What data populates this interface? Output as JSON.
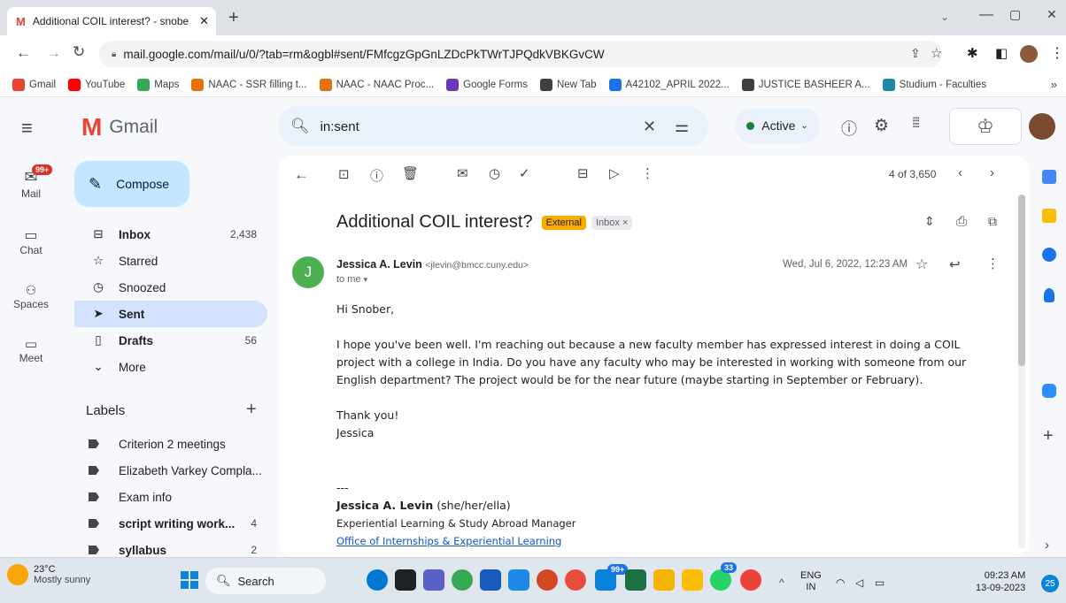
{
  "browser": {
    "tab_title": "Additional COIL interest? - snobe",
    "url": "mail.google.com/mail/u/0/?tab=rm&ogbl#sent/FMfcgzGpGnLZDcPkTWrTJPQdkVBKGvCW",
    "bookmarks": [
      {
        "label": "Gmail",
        "color": "#ea4335"
      },
      {
        "label": "YouTube",
        "color": "#ff0000"
      },
      {
        "label": "Maps",
        "color": "#34a853"
      },
      {
        "label": "NAAC - SSR filling t...",
        "color": "#e8710a"
      },
      {
        "label": "NAAC - NAAC Proc...",
        "color": "#e8710a"
      },
      {
        "label": "Google Forms",
        "color": "#673ab7"
      },
      {
        "label": "New Tab",
        "color": "#3c4043"
      },
      {
        "label": "A42102_APRIL 2022...",
        "color": "#1a73e8"
      },
      {
        "label": "JUSTICE BASHEER A...",
        "color": "#3c4043"
      },
      {
        "label": "Studium - Faculties",
        "color": "#1e88a8"
      }
    ],
    "more": "»"
  },
  "gmail": {
    "logo_text": "Gmail",
    "search_value": "in:sent",
    "status": "Active",
    "rail": [
      {
        "label": "Mail",
        "badge": "99+"
      },
      {
        "label": "Chat"
      },
      {
        "label": "Spaces"
      },
      {
        "label": "Meet"
      }
    ],
    "compose_label": "Compose",
    "nav": [
      {
        "label": "Inbox",
        "count": "2,438",
        "bold": true
      },
      {
        "label": "Starred",
        "count": "",
        "bold": false
      },
      {
        "label": "Snoozed",
        "count": "",
        "bold": false
      },
      {
        "label": "Sent",
        "count": "",
        "bold": true
      },
      {
        "label": "Drafts",
        "count": "56",
        "bold": true
      },
      {
        "label": "More",
        "count": "",
        "bold": false
      }
    ],
    "labels_heading": "Labels",
    "labels": [
      {
        "label": "Criterion 2 meetings",
        "count": "",
        "bold": false
      },
      {
        "label": "Elizabeth Varkey Compla...",
        "count": "",
        "bold": false
      },
      {
        "label": "Exam info",
        "count": "",
        "bold": false
      },
      {
        "label": "script writing work...",
        "count": "4",
        "bold": true
      },
      {
        "label": "syllabus",
        "count": "2",
        "bold": true
      }
    ],
    "pager": "4 of 3,650",
    "email": {
      "subject": "Additional COIL interest?",
      "tag_external": "External",
      "tag_inbox": "Inbox",
      "avatar_letter": "J",
      "sender_name": "Jessica A. Levin",
      "sender_email": "<jlevin@bmcc.cuny.edu>",
      "to": "to me",
      "date": "Wed, Jul 6, 2022, 12:23 AM",
      "greeting": "Hi Snober,",
      "body": "I hope you've been well. I'm reaching out because a new faculty member has expressed interest in doing a COIL project with a college in India. Do you have any faculty who may be interested in working with someone from our English department? The project would be for the near future (maybe starting in September or February).",
      "thanks": "Thank you!",
      "signoff": "Jessica",
      "separator": "---",
      "sig_name": "Jessica A. Levin",
      "sig_pronouns": "(she/her/ella)",
      "sig_title": "Experiential Learning & Study Abroad Manager",
      "sig_link": "Office of Internships & Experiential Learning"
    }
  },
  "taskbar": {
    "weather_temp": "23°C",
    "weather_desc": "Mostly sunny",
    "search_label": "Search",
    "lang": "ENG",
    "region": "IN",
    "time": "09:23 AM",
    "date": "13-09-2023",
    "notif": "25",
    "badge_a": "99+",
    "badge_b": "33"
  }
}
